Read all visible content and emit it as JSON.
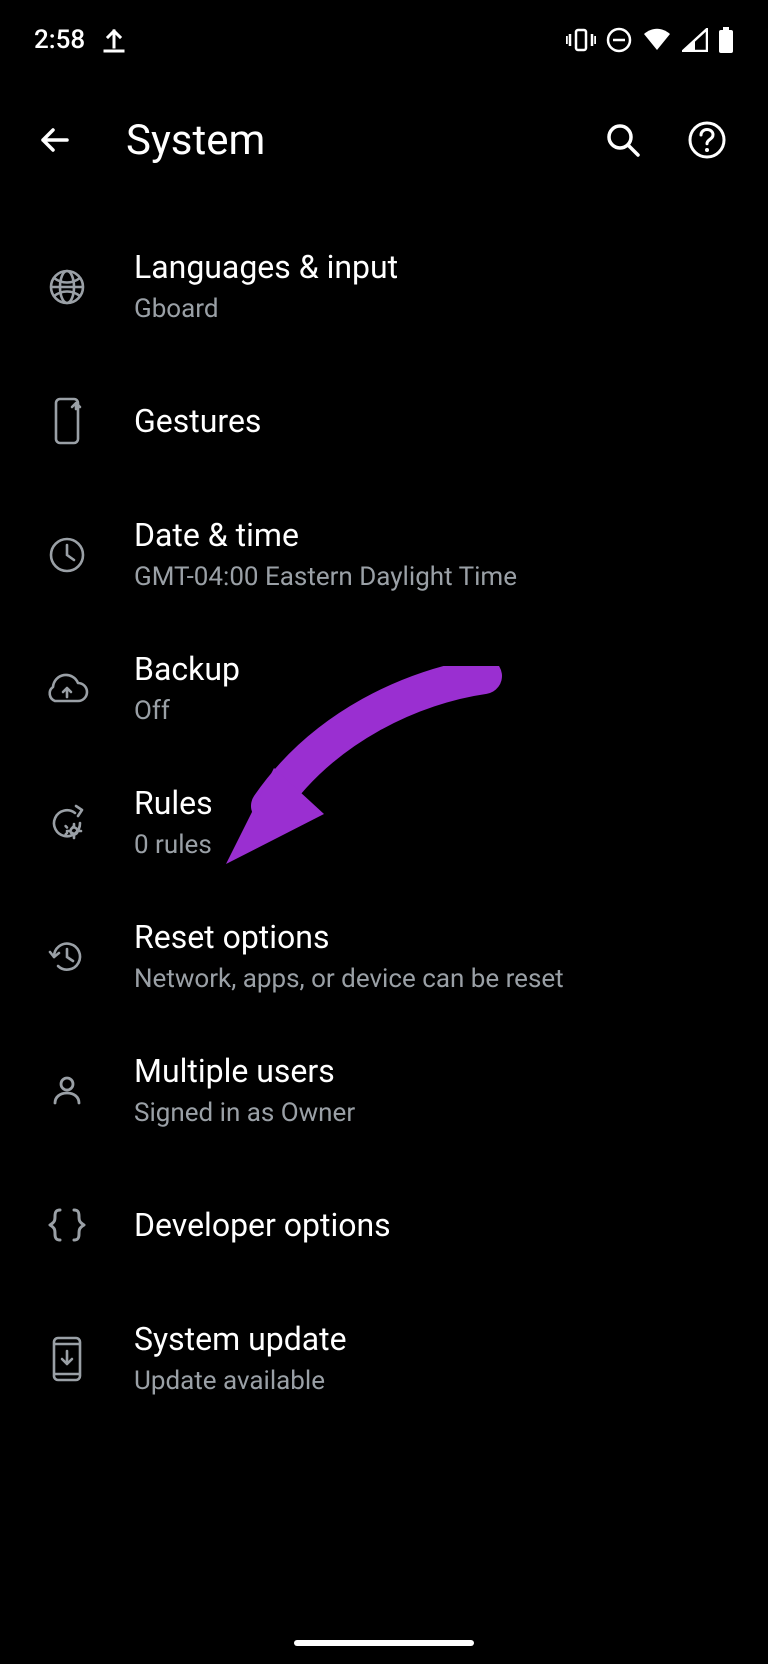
{
  "status": {
    "time": "2:58"
  },
  "header": {
    "title": "System"
  },
  "items": [
    {
      "title": "Languages & input",
      "sub": "Gboard"
    },
    {
      "title": "Gestures",
      "sub": ""
    },
    {
      "title": "Date & time",
      "sub": "GMT-04:00 Eastern Daylight Time"
    },
    {
      "title": "Backup",
      "sub": "Off"
    },
    {
      "title": "Rules",
      "sub": "0 rules"
    },
    {
      "title": "Reset options",
      "sub": "Network, apps, or device can be reset"
    },
    {
      "title": "Multiple users",
      "sub": "Signed in as Owner"
    },
    {
      "title": "Developer options",
      "sub": ""
    },
    {
      "title": "System update",
      "sub": "Update available"
    }
  ]
}
